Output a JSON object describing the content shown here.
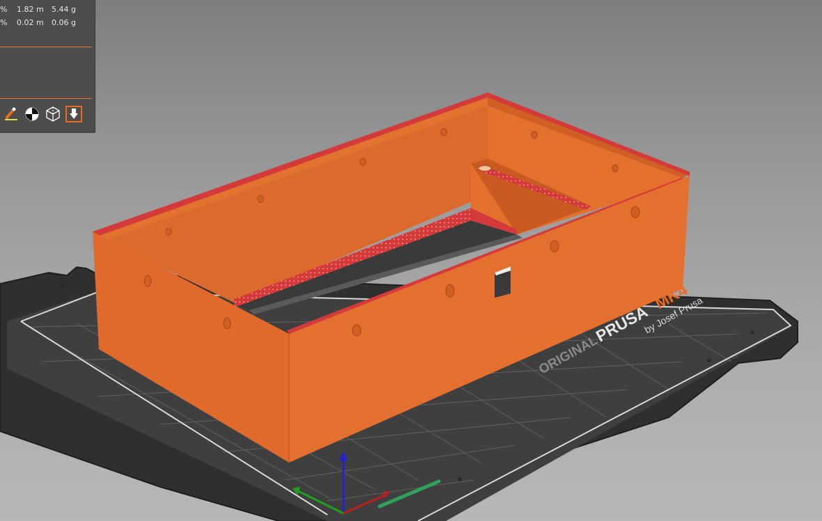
{
  "stats": {
    "rows": [
      {
        "percent": "%",
        "length": "1.82 m",
        "weight": "5.44 g"
      },
      {
        "percent": "%",
        "length": "0.02 m",
        "weight": "0.06 g"
      }
    ]
  },
  "toolbar": {
    "items": [
      {
        "icon": "paint-brush-icon",
        "active": false
      },
      {
        "icon": "seam-icon",
        "active": false
      },
      {
        "icon": "wireframe-cube-icon",
        "active": false
      },
      {
        "icon": "place-on-face-icon",
        "active": true
      }
    ]
  },
  "bed": {
    "brand_prefix": "ORIGINAL",
    "brand_name": "PRUSA",
    "brand_model": "MK4",
    "brand_byline": "by Josef Prusa"
  },
  "colors": {
    "model_orange": "#e06a2c",
    "perimeter_red": "#d53a3a",
    "accent": "#ed6b21",
    "bed": "#3a3a3a"
  }
}
